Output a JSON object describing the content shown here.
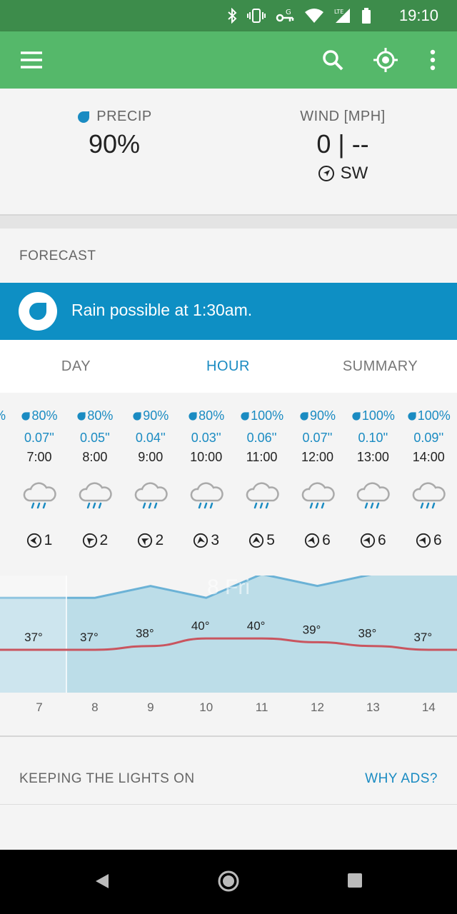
{
  "status": {
    "time": "19:10",
    "network": "LTE"
  },
  "current": {
    "precip_label": "PRECIP",
    "precip_value": "90%",
    "wind_label": "WIND [MPH]",
    "wind_value": "0 | --",
    "wind_direction": "SW"
  },
  "forecast": {
    "title": "FORECAST",
    "alert": "Rain possible at 1:30am.",
    "tabs": [
      "DAY",
      "HOUR",
      "SUMMARY"
    ],
    "active_tab": "HOUR",
    "hours": [
      {
        "pct": "80%",
        "amount": "0.07''",
        "time": "7:00",
        "wind": "1",
        "temp": "37°"
      },
      {
        "pct": "80%",
        "amount": "0.05''",
        "time": "8:00",
        "wind": "2",
        "temp": "37°"
      },
      {
        "pct": "90%",
        "amount": "0.04''",
        "time": "9:00",
        "wind": "2",
        "temp": "38°"
      },
      {
        "pct": "80%",
        "amount": "0.03''",
        "time": "10:00",
        "wind": "3",
        "temp": "40°"
      },
      {
        "pct": "100%",
        "amount": "0.06''",
        "time": "11:00",
        "wind": "5",
        "temp": "40°"
      },
      {
        "pct": "90%",
        "amount": "0.07''",
        "time": "12:00",
        "wind": "6",
        "temp": "39°"
      },
      {
        "pct": "100%",
        "amount": "0.10''",
        "time": "13:00",
        "wind": "6",
        "temp": "38°"
      },
      {
        "pct": "100%",
        "amount": "0.09''",
        "time": "14:00",
        "wind": "6",
        "temp": "37°"
      }
    ],
    "day_marker": "8 Fri",
    "x_labels": [
      "7",
      "8",
      "9",
      "10",
      "11",
      "12",
      "13",
      "14"
    ]
  },
  "chart_data": {
    "type": "line",
    "x": [
      7,
      8,
      9,
      10,
      11,
      12,
      13,
      14
    ],
    "series": [
      {
        "values": [
          37,
          37,
          38,
          40,
          40,
          39,
          38,
          37
        ]
      }
    ],
    "data_labels": [
      "37°",
      "37°",
      "38°",
      "40°",
      "40°",
      "39°",
      "38°",
      "37°"
    ],
    "precip_probability": [
      80,
      80,
      90,
      80,
      100,
      90,
      100,
      100
    ],
    "annotation": "8 Fri",
    "colors": {
      "temperature": "#c9555f",
      "precip_fill": "#bcdde8",
      "precip_line": "#6bb2d6"
    }
  },
  "ads": {
    "title": "KEEPING THE LIGHTS ON",
    "link": "WHY ADS?"
  },
  "colors": {
    "status_bar": "#3d8c4b",
    "app_bar": "#55b86a",
    "accent": "#1a8bc2",
    "alert": "#0e8fc4"
  }
}
